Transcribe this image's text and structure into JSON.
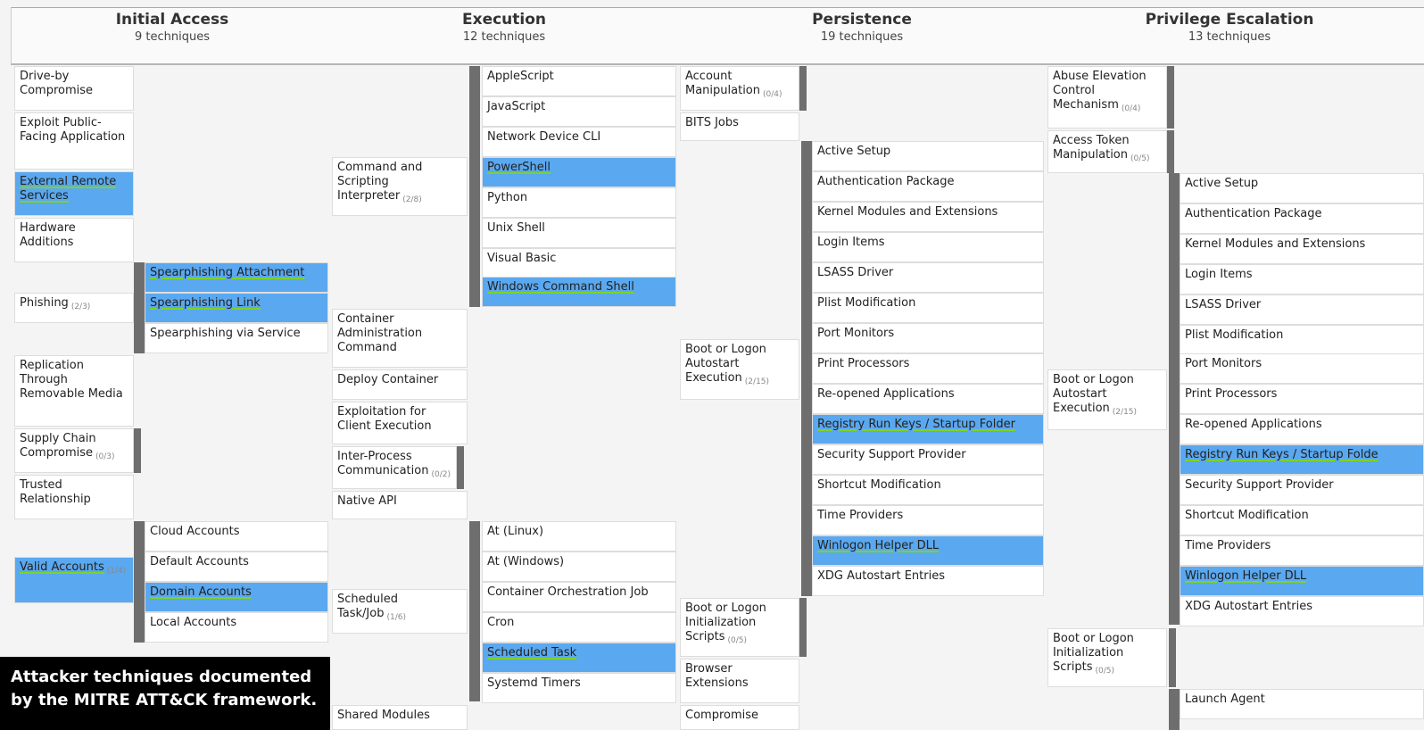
{
  "tactics": [
    {
      "name": "Initial Access",
      "count": "9 techniques"
    },
    {
      "name": "Execution",
      "count": "12 techniques"
    },
    {
      "name": "Persistence",
      "count": "19 techniques"
    },
    {
      "name": "Privilege Escalation",
      "count": "13 techniques"
    }
  ],
  "caption": "Attacker techniques documented by the MITRE ATT&CK framework.",
  "cells": {
    "drive_by": "Drive-by Compromise",
    "exploit_public": "Exploit Public-Facing Application",
    "external_remote": "External Remote Services",
    "hardware": "Hardware Additions",
    "phishing": "Phishing",
    "phishing_cnt": "(2/3)",
    "sp_attach": "Spearphishing Attachment",
    "sp_link": "Spearphishing Link",
    "sp_service": "Spearphishing via Service",
    "replication": "Replication Through Removable Media",
    "supply": "Supply Chain Compromise",
    "supply_cnt": "(0/3)",
    "trusted": "Trusted Relationship",
    "valid": "Valid Accounts",
    "valid_cnt": "(1/4)",
    "cloud_acc": "Cloud Accounts",
    "default_acc": "Default Accounts",
    "domain_acc": "Domain Accounts",
    "local_acc": "Local Accounts",
    "cmd_script": "Command and Scripting Interpreter",
    "cmd_script_cnt": "(2/8)",
    "applescript": "AppleScript",
    "javascript": "JavaScript",
    "netcli": "Network Device CLI",
    "powershell": "PowerShell",
    "python": "Python",
    "unix": "Unix Shell",
    "vb": "Visual Basic",
    "wincmd": "Windows Command Shell",
    "container_admin": "Container Administration Command",
    "deploy_container": "Deploy Container",
    "exploit_client": "Exploitation for Client Execution",
    "ipc": "Inter-Process Communication",
    "ipc_cnt": "(0/2)",
    "native_api": "Native API",
    "sched": "Scheduled Task/Job",
    "sched_cnt": "(1/6)",
    "at_linux": "At (Linux)",
    "at_windows": "At (Windows)",
    "container_orch": "Container Orchestration Job",
    "cron": "Cron",
    "sched_task": "Scheduled Task",
    "systemd": "Systemd Timers",
    "shared_modules": "Shared Modules",
    "account_manip": "Account Manipulation",
    "account_manip_cnt": "(0/4)",
    "bits": "BITS Jobs",
    "boot_logon": "Boot or Logon Autostart Execution",
    "boot_logon_cnt": "(2/15)",
    "active_setup": "Active Setup",
    "auth_pkg": "Authentication Package",
    "kernel_mod": "Kernel Modules and Extensions",
    "login_items": "Login Items",
    "lsass": "LSASS Driver",
    "plist": "Plist Modification",
    "port_mon": "Port Monitors",
    "print_proc": "Print Processors",
    "reopened": "Re-opened Applications",
    "reg_run": "Registry Run Keys / Startup Folder",
    "ssp": "Security Support Provider",
    "shortcut": "Shortcut Modification",
    "time_prov": "Time Providers",
    "winlogon": "Winlogon Helper DLL",
    "xdg": "XDG Autostart Entries",
    "boot_init": "Boot or Logon Initialization Scripts",
    "boot_init_cnt": "(0/5)",
    "browser_ext": "Browser Extensions",
    "compromise": "Compromise",
    "abuse_elev": "Abuse Elevation Control Mechanism",
    "abuse_elev_cnt": "(0/4)",
    "access_token": "Access Token Manipulation",
    "access_token_cnt": "(0/5)",
    "reg_run_pe": "Registry Run Keys / Startup Folde",
    "launch_agent": "Launch Agent"
  }
}
